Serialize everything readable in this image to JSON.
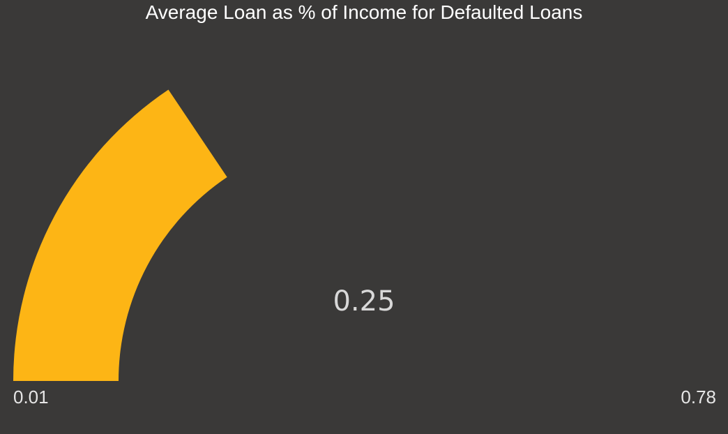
{
  "title": "Average Loan as % of Income for Defaulted Loans",
  "chart_data": {
    "type": "gauge",
    "title": "Average Loan as % of Income for Defaulted Loans",
    "value": 0.25,
    "value_label": "0.25",
    "min": 0.01,
    "max": 0.78,
    "min_label": "0.01",
    "max_label": "0.78",
    "fill_color": "#fdb515",
    "background_color": "#3a3938"
  }
}
